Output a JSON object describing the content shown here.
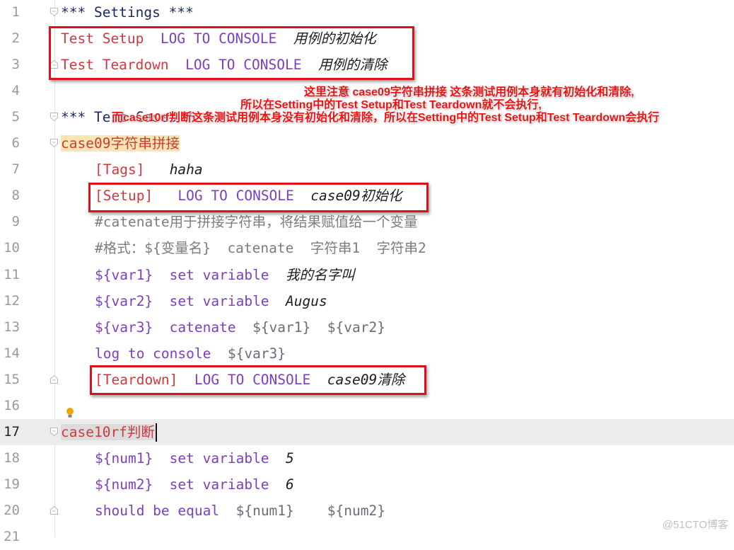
{
  "editor": {
    "current_line": 17,
    "lines": [
      {
        "n": "1",
        "segments": [
          {
            "t": "*** Settings ***",
            "c": "c-sect"
          }
        ]
      },
      {
        "n": "2",
        "segments": [
          {
            "t": "Test Setup",
            "c": "c-red"
          },
          {
            "t": "  ",
            "c": ""
          },
          {
            "t": "LOG TO CONSOLE",
            "c": "c-kw"
          },
          {
            "t": "  ",
            "c": ""
          },
          {
            "t": "用例的初始化",
            "c": "c-argcjk"
          }
        ]
      },
      {
        "n": "3",
        "segments": [
          {
            "t": "Test Teardown",
            "c": "c-red"
          },
          {
            "t": "  ",
            "c": ""
          },
          {
            "t": "LOG TO CONSOLE",
            "c": "c-kw"
          },
          {
            "t": "  ",
            "c": ""
          },
          {
            "t": "用例的清除",
            "c": "c-argcjk"
          }
        ]
      },
      {
        "n": "4",
        "segments": []
      },
      {
        "n": "5",
        "segments": [
          {
            "t": "*** Test Cases ***",
            "c": "c-sect"
          }
        ]
      },
      {
        "n": "6",
        "segments": [
          {
            "t": "case09字符串拼接",
            "c": "c-red case-hl"
          }
        ]
      },
      {
        "n": "7",
        "segments": [
          {
            "t": "[Tags]",
            "c": "c-red"
          },
          {
            "t": "   ",
            "c": ""
          },
          {
            "t": "haha",
            "c": "c-arg"
          }
        ]
      },
      {
        "n": "8",
        "segments": [
          {
            "t": "[Setup]",
            "c": "c-red"
          },
          {
            "t": "   ",
            "c": ""
          },
          {
            "t": "LOG TO CONSOLE",
            "c": "c-kw"
          },
          {
            "t": "  ",
            "c": ""
          },
          {
            "t": "case09",
            "c": "c-arg"
          },
          {
            "t": "初始化",
            "c": "c-argcjk"
          }
        ]
      },
      {
        "n": "9",
        "segments": [
          {
            "t": "#catenate用于拼接字符串，将结果赋值给一个变量",
            "c": "c-comment"
          }
        ]
      },
      {
        "n": "10",
        "segments": [
          {
            "t": "#格式：${变量名}  catenate  字符串1  字符串2",
            "c": "c-comment"
          }
        ]
      },
      {
        "n": "11",
        "segments": [
          {
            "t": "${var1}",
            "c": "c-var"
          },
          {
            "t": "  ",
            "c": ""
          },
          {
            "t": "set variable",
            "c": "c-kw"
          },
          {
            "t": "  ",
            "c": ""
          },
          {
            "t": "我的名字叫",
            "c": "c-argcjk"
          }
        ]
      },
      {
        "n": "12",
        "segments": [
          {
            "t": "${var2}",
            "c": "c-var"
          },
          {
            "t": "  ",
            "c": ""
          },
          {
            "t": "set variable",
            "c": "c-kw"
          },
          {
            "t": "  ",
            "c": ""
          },
          {
            "t": "Augus",
            "c": "c-arg"
          }
        ]
      },
      {
        "n": "13",
        "segments": [
          {
            "t": "${var3}",
            "c": "c-var"
          },
          {
            "t": "  ",
            "c": ""
          },
          {
            "t": "catenate",
            "c": "c-kw"
          },
          {
            "t": "  ",
            "c": ""
          },
          {
            "t": "${var1}",
            "c": "c-plainvar"
          },
          {
            "t": "  ",
            "c": ""
          },
          {
            "t": "${var2}",
            "c": "c-plainvar"
          }
        ]
      },
      {
        "n": "14",
        "segments": [
          {
            "t": "log to console",
            "c": "c-kw"
          },
          {
            "t": "  ",
            "c": ""
          },
          {
            "t": "${var3}",
            "c": "c-plainvar"
          }
        ]
      },
      {
        "n": "15",
        "segments": [
          {
            "t": "[Teardown]",
            "c": "c-red"
          },
          {
            "t": "  ",
            "c": ""
          },
          {
            "t": "LOG TO CONSOLE",
            "c": "c-kw"
          },
          {
            "t": "  ",
            "c": ""
          },
          {
            "t": "case09",
            "c": "c-arg"
          },
          {
            "t": "清除",
            "c": "c-argcjk"
          }
        ]
      },
      {
        "n": "16",
        "segments": []
      },
      {
        "n": "17",
        "segments": [
          {
            "t": "case10rf判断",
            "c": "c-red case-sel"
          }
        ]
      },
      {
        "n": "18",
        "segments": [
          {
            "t": "${num1}",
            "c": "c-var"
          },
          {
            "t": "  ",
            "c": ""
          },
          {
            "t": "set variable",
            "c": "c-kw"
          },
          {
            "t": "  ",
            "c": ""
          },
          {
            "t": "5",
            "c": "c-arg"
          }
        ]
      },
      {
        "n": "19",
        "segments": [
          {
            "t": "${num2}",
            "c": "c-var"
          },
          {
            "t": "  ",
            "c": ""
          },
          {
            "t": "set variable",
            "c": "c-kw"
          },
          {
            "t": "  ",
            "c": ""
          },
          {
            "t": "6",
            "c": "c-arg"
          }
        ]
      },
      {
        "n": "20",
        "segments": [
          {
            "t": "should be equal",
            "c": "c-kw"
          },
          {
            "t": "  ",
            "c": ""
          },
          {
            "t": "${num1}",
            "c": "c-plainvar"
          },
          {
            "t": "    ",
            "c": ""
          },
          {
            "t": "${num2}",
            "c": "c-plainvar"
          }
        ]
      },
      {
        "n": "21",
        "segments": []
      }
    ]
  },
  "annotation": {
    "line1": "这里注意 case09字符串拼接 这条测试用例本身就有初始化和清除,",
    "line2": "所以在Setting中的Test Setup和Test Teardown就不会执行,",
    "line3": "而case10rf判断这条测试用例本身没有初始化和清除，所以在Setting中的Test Setup和Test Teardown会执行"
  },
  "icons": {
    "bulb": "lightbulb-icon",
    "fold": "fold-marker-icon"
  },
  "colors": {
    "highlight_box": "#e0101a",
    "keyword": "#7b3fc4",
    "setting": "#d0383f",
    "section": "#1b2a5c"
  },
  "watermark": "@51CTO博客"
}
